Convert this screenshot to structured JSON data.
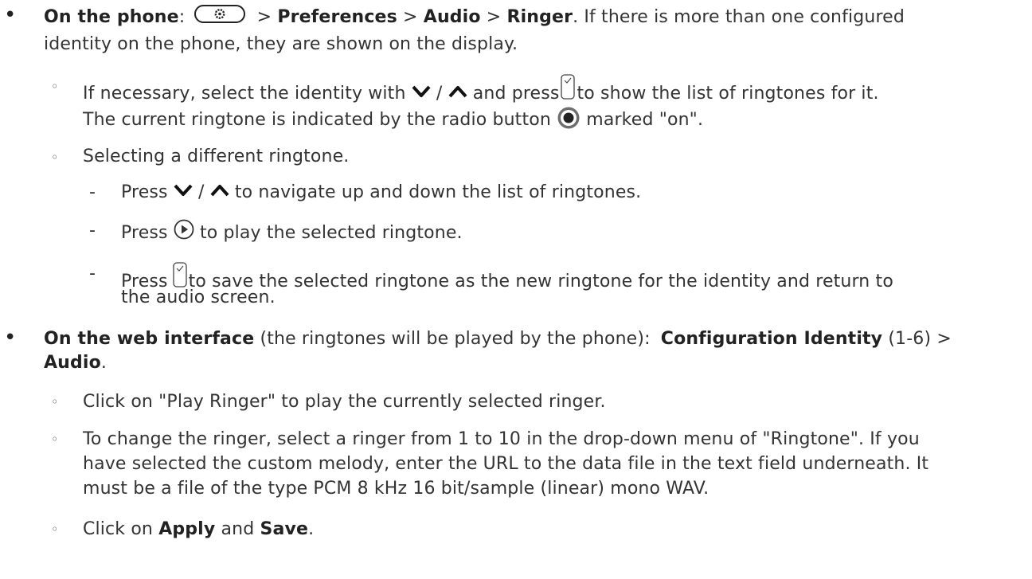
{
  "phone": {
    "label": "On the phone",
    "colon": ":",
    "sep": ">",
    "menu1": "Preferences",
    "menu2": "Audio",
    "menu3": "Ringer",
    "tail": ". If there is more than one configured",
    "line2": "identity on the phone, they are shown on the display.",
    "identity_a": "If necessary, select the identity with",
    "slash": "/",
    "identity_b": "and press",
    "identity_c": "to show the list of ringtones for it.",
    "current_a": "The current ringtone is indicated by the radio button",
    "current_b": "marked \"on\".",
    "selecting": "Selecting a different ringtone.",
    "press": "Press",
    "nav_tail": "to navigate up and down the list of ringtones.",
    "play_tail": "to play the selected ringtone.",
    "save_tail": "to save the selected ringtone as the new ringtone for the identity and return to",
    "save_line2": "the audio screen."
  },
  "web": {
    "label": "On the web interface",
    "paren": "(the ringtones will be played by the phone):",
    "config": "Configuration Identity",
    "range": "(1-6) >",
    "audio": "Audio",
    "period": ".",
    "click_play": "Click on \"Play Ringer\" to play the currently selected ringer.",
    "change1": "To change the ringer, select a ringer from 1 to 10 in the drop-down menu of \"Ringtone\". If you",
    "change2": "have selected the custom melody, enter the URL to the data file in the text field underneath. It",
    "change3": "must be a file of the type PCM 8 kHz 16 bit/sample (linear) mono WAV.",
    "click_on": "Click on",
    "apply": "Apply",
    "and": "and",
    "save": "Save",
    "end": "."
  },
  "glyphs": {
    "bullet": "•",
    "sub_bullet": "◦",
    "dash": "-"
  },
  "icons": {
    "settings_key": "gear-key-icon",
    "down": "chevron-down-icon",
    "up": "chevron-up-icon",
    "ok": "check-key-icon",
    "radio_on": "radio-on-icon",
    "play": "play-icon"
  }
}
